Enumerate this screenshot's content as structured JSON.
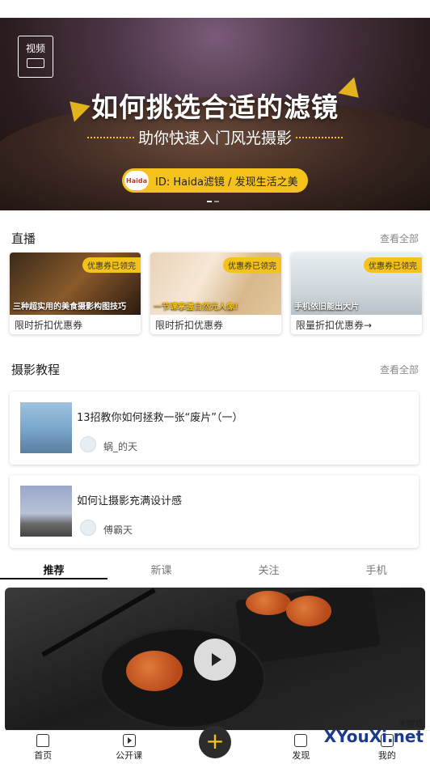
{
  "banner": {
    "tag": "视频",
    "title": "如何挑选合适的滤镜",
    "subtitle": "助你快速入门风光摄影",
    "brand_logo": "Haida",
    "pill_text": "ID: Haida滤镜 / 发现生活之美"
  },
  "live": {
    "heading": "直播",
    "more": "查看全部",
    "cards": [
      {
        "badge": "优惠券已领完",
        "caption": "三种超实用的美食摄影构图技巧",
        "label": "限时折扣优惠券"
      },
      {
        "badge": "优惠券已领完",
        "caption": "一节课掌握自然光人像！",
        "label": "限时折扣优惠券"
      },
      {
        "badge": "优惠券已领完",
        "caption": "手机依旧能出大片",
        "label": "限量折扣优惠券→"
      }
    ]
  },
  "tutorials": {
    "heading": "摄影教程",
    "more": "查看全部",
    "items": [
      {
        "title": "13招教你如何拯救一张“废片”（一）",
        "author": "蜗_的天"
      },
      {
        "title": "如何让摄影充满设计感",
        "author": "傅霸天"
      }
    ]
  },
  "tabs": [
    "推荐",
    "新课",
    "关注",
    "手机"
  ],
  "nav": {
    "home": "首页",
    "courses": "公开课",
    "plus": "+",
    "discover": "发现",
    "mine": "我的"
  },
  "watermark": {
    "small": "X游戏",
    "main": "XYouXi.net"
  },
  "colors": {
    "accent": "#f4c21a",
    "dark": "#2c2c2c"
  }
}
